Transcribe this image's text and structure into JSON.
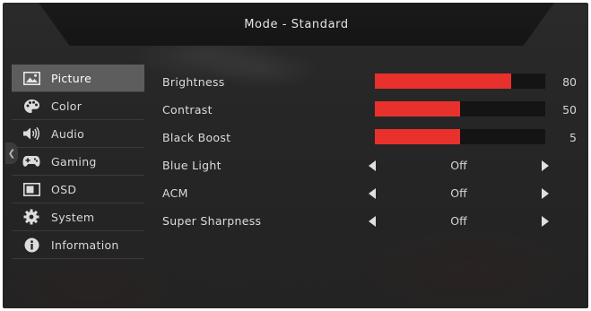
{
  "header": {
    "title": "Mode - Standard"
  },
  "sidebar": {
    "items": [
      {
        "label": "Picture",
        "icon": "picture-icon",
        "active": true
      },
      {
        "label": "Color",
        "icon": "palette-icon",
        "active": false
      },
      {
        "label": "Audio",
        "icon": "speaker-icon",
        "active": false
      },
      {
        "label": "Gaming",
        "icon": "gamepad-icon",
        "active": false
      },
      {
        "label": "OSD",
        "icon": "osd-window-icon",
        "active": false
      },
      {
        "label": "System",
        "icon": "gear-icon",
        "active": false
      },
      {
        "label": "Information",
        "icon": "info-icon",
        "active": false
      }
    ]
  },
  "settings": {
    "brightness": {
      "label": "Brightness",
      "value": "80",
      "level": 0.8
    },
    "contrast": {
      "label": "Contrast",
      "value": "50",
      "level": 0.5
    },
    "black_boost": {
      "label": "Black Boost",
      "value": "5",
      "level": 0.5
    },
    "blue_light": {
      "label": "Blue Light",
      "value": "Off"
    },
    "acm": {
      "label": "ACM",
      "value": "Off"
    },
    "super_sharpness": {
      "label": "Super Sharpness",
      "value": "Off"
    }
  },
  "colors": {
    "accent": "#e8312c",
    "active_tab": "#5d5d5d",
    "background": "#262626"
  }
}
